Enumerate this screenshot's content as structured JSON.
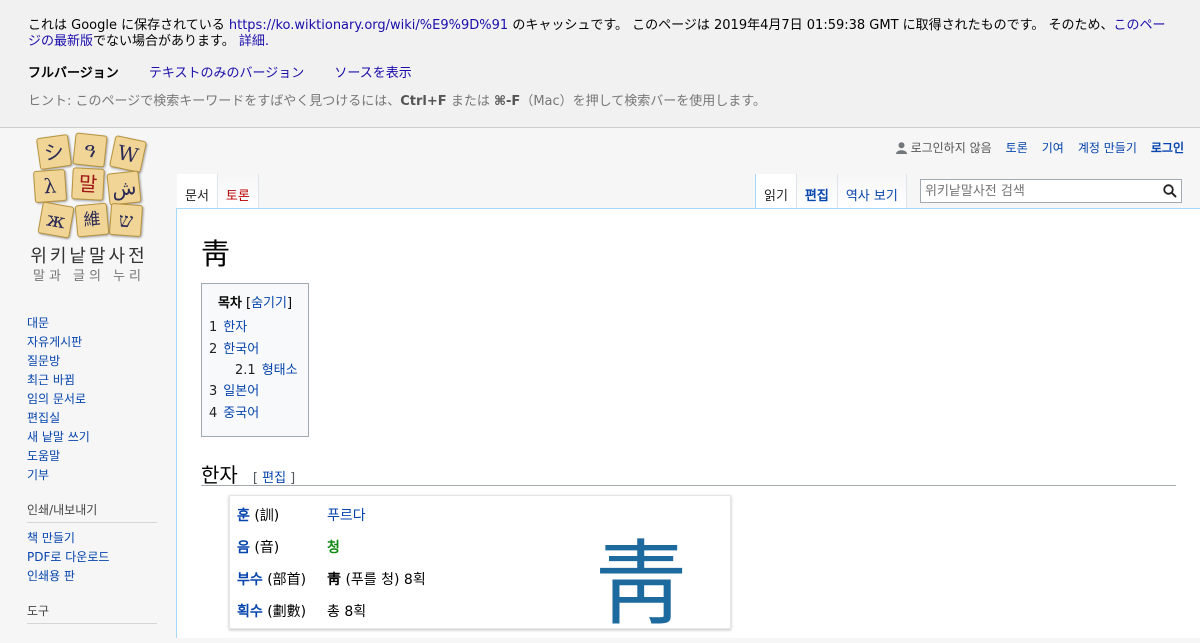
{
  "cache_banner": {
    "prefix": "これは Google に保存されている",
    "url": "https://ko.wiktionary.org/wiki/%E9%9D%91",
    "middle": "のキャッシュです。 このページは 2019年4月7日 01:59:38 GMT に取得されたものです。 そのため、",
    "latest_link": "このページの最新版",
    "suffix": "でない場合があります。",
    "details_link": "詳細.",
    "versions": {
      "full": "フルバージョン",
      "text_only": "テキストのみのバージョン",
      "source": "ソースを表示"
    },
    "hint_prefix": "ヒント: このページで検索キーワードをすばやく見つけるには、",
    "hint_key1": "Ctrl+F",
    "hint_mid": "または",
    "hint_key2": "⌘-F",
    "hint_suffix": "（Mac）を押して検索バーを使用します。"
  },
  "logo": {
    "tiles": [
      "シ",
      "ዓ",
      "W",
      "λ",
      "말",
      "ش",
      "ж",
      "維",
      "ש"
    ],
    "name": "위키낱말사전",
    "tagline": "말과 글의 누리"
  },
  "personal_tools": {
    "not_logged_in": "로그인하지 않음",
    "talk": "토론",
    "contributions": "기여",
    "create_account": "계정 만들기",
    "login": "로그인"
  },
  "tabs": {
    "article": "문서",
    "talk": "토론",
    "read": "읽기",
    "edit": "편집",
    "history": "역사 보기"
  },
  "search": {
    "placeholder": "위키낱말사전 검색"
  },
  "sidebar": {
    "nav": [
      "대문",
      "자유게시판",
      "질문방",
      "최근 바뀜",
      "임의 문서로",
      "편집실",
      "새 낱말 쓰기",
      "도움말",
      "기부"
    ],
    "print_heading": "인쇄/내보내기",
    "print": [
      "책 만들기",
      "PDF로 다운로드",
      "인쇄용 판"
    ],
    "tools_heading": "도구"
  },
  "page": {
    "title": "靑",
    "toc": {
      "heading": "목차",
      "toggle": "숨기기",
      "items": [
        {
          "num": "1",
          "label": "한자"
        },
        {
          "num": "2",
          "label": "한국어"
        },
        {
          "num": "2.1",
          "label": "형태소"
        },
        {
          "num": "3",
          "label": "일본어"
        },
        {
          "num": "4",
          "label": "중국어"
        }
      ]
    },
    "section": {
      "title": "한자",
      "edit": "편집"
    },
    "infobox": {
      "rows": [
        {
          "key": "훈",
          "key_hanja": "(訓)",
          "value": "푸르다"
        },
        {
          "key": "음",
          "key_hanja": "(音)",
          "value": "청"
        },
        {
          "key": "부수",
          "key_hanja": "(部首)",
          "value_char": "靑",
          "value": "(푸를 청) 8획"
        },
        {
          "key": "획수",
          "key_hanja": "(劃數)",
          "value": "총 8획"
        }
      ],
      "big_char": "靑"
    }
  }
}
